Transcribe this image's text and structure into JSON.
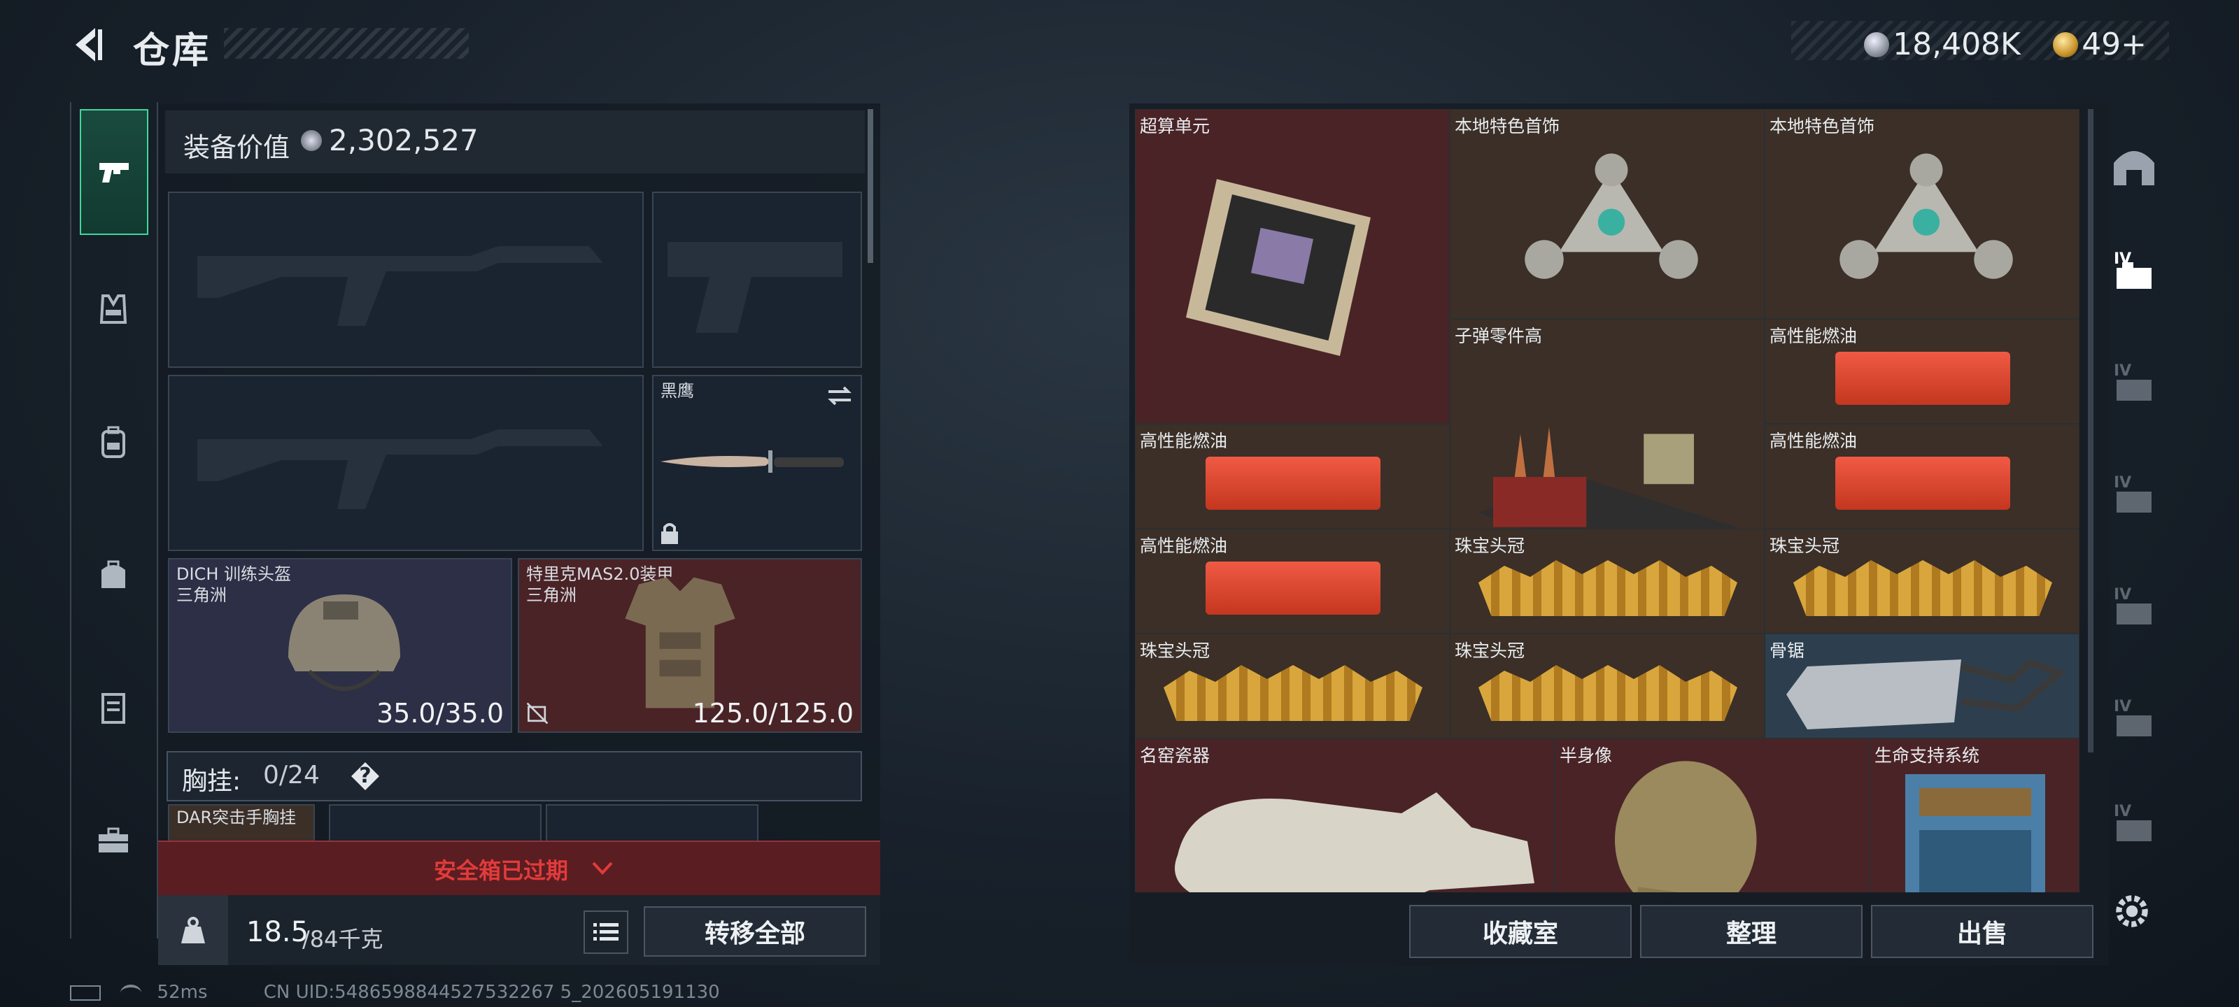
{
  "header": {
    "title": "仓库",
    "currency_silver": "18,408K",
    "currency_gold": "49+"
  },
  "left_nav": [
    "pistol-icon",
    "vest-icon",
    "backpack-icon",
    "bag-icon",
    "case-icon",
    "toolbox-icon"
  ],
  "equipment": {
    "value_label": "装备价值",
    "value": "2,302,527",
    "knife": {
      "name": "黑鹰"
    },
    "helmet": {
      "name": "DICH 训练头盔",
      "origin": "三角洲",
      "durability": "35.0/35.0"
    },
    "armor": {
      "name": "特里克MAS2.0装甲",
      "origin": "三角洲",
      "durability": "125.0/125.0"
    },
    "chest": {
      "label": "胸挂:",
      "capacity": "0/24",
      "help": "?"
    },
    "chest_item": {
      "name": "DAR突击手胸挂"
    }
  },
  "expired_label": "安全箱已过期",
  "weight": {
    "current": "18.5",
    "max": "/84千克"
  },
  "buttons": {
    "transfer_all": "转移全部",
    "collection": "收藏室",
    "sort": "整理",
    "sell": "出售"
  },
  "items": [
    "超算单元",
    "本地特色首饰",
    "本地特色首饰",
    "子弹零件高",
    "高性能燃油",
    "高性能燃油",
    "高性能燃油",
    "高性能燃油",
    "珠宝头冠",
    "珠宝头冠",
    "珠宝头冠",
    "珠宝头冠",
    "骨锯",
    "名窑瓷器",
    "半身像",
    "生命支持系统"
  ],
  "status": {
    "ping": "52ms",
    "uid": "CN UID:5486598844527532267 5_202605191130"
  },
  "colors": {
    "accent_green": "#3fd89a",
    "rare_red": "#4a2326",
    "epic_brown": "#3b2f27",
    "blue": "#2d3f4f",
    "warn_red": "#e23b3b"
  }
}
